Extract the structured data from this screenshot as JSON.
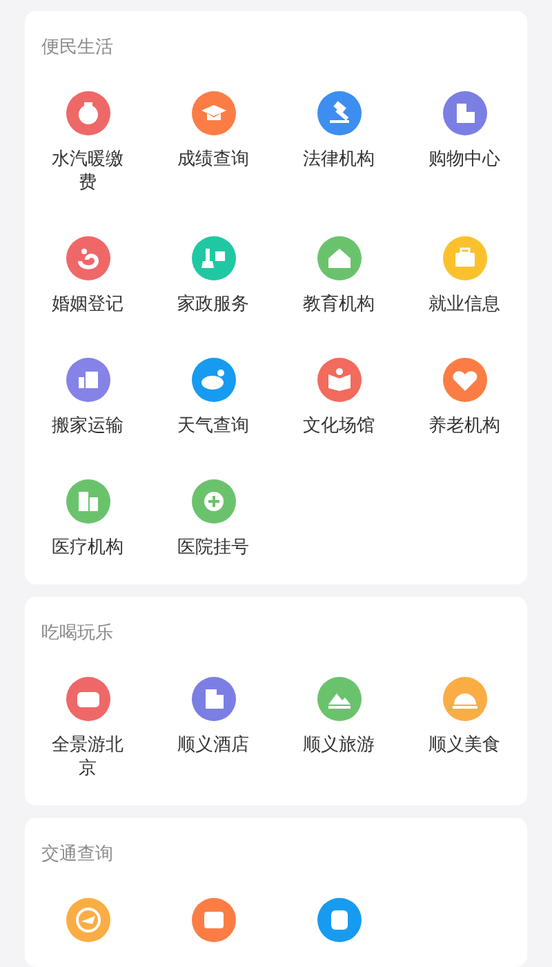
{
  "sections": [
    {
      "title": "便民生活",
      "items": [
        {
          "label": "水汽暖缴费",
          "color": "#ef6868"
        },
        {
          "label": "成绩查询",
          "color": "#fb7d45"
        },
        {
          "label": "法律机构",
          "color": "#3d8ef0"
        },
        {
          "label": "购物中心",
          "color": "#7b7fe4"
        },
        {
          "label": "婚姻登记",
          "color": "#ef6868"
        },
        {
          "label": "家政服务",
          "color": "#1fc8a3"
        },
        {
          "label": "教育机构",
          "color": "#6ac36c"
        },
        {
          "label": "就业信息",
          "color": "#fbc12d"
        },
        {
          "label": "搬家运输",
          "color": "#8582e8"
        },
        {
          "label": "天气查询",
          "color": "#179bf0"
        },
        {
          "label": "文化场馆",
          "color": "#f26b5c"
        },
        {
          "label": "养老机构",
          "color": "#fb7d45"
        },
        {
          "label": "医疗机构",
          "color": "#6ac36c"
        },
        {
          "label": "医院挂号",
          "color": "#6ac36c"
        }
      ]
    },
    {
      "title": "吃喝玩乐",
      "items": [
        {
          "label": "全景游北京",
          "color": "#ef6868"
        },
        {
          "label": "顺义酒店",
          "color": "#7b7fe4"
        },
        {
          "label": "顺义旅游",
          "color": "#6ac36c"
        },
        {
          "label": "顺义美食",
          "color": "#fbad45"
        }
      ]
    },
    {
      "title": "交通查询",
      "items": [
        {
          "color": "#fbad45"
        },
        {
          "color": "#fb7d45"
        },
        {
          "color": "#179bf0"
        }
      ]
    }
  ]
}
